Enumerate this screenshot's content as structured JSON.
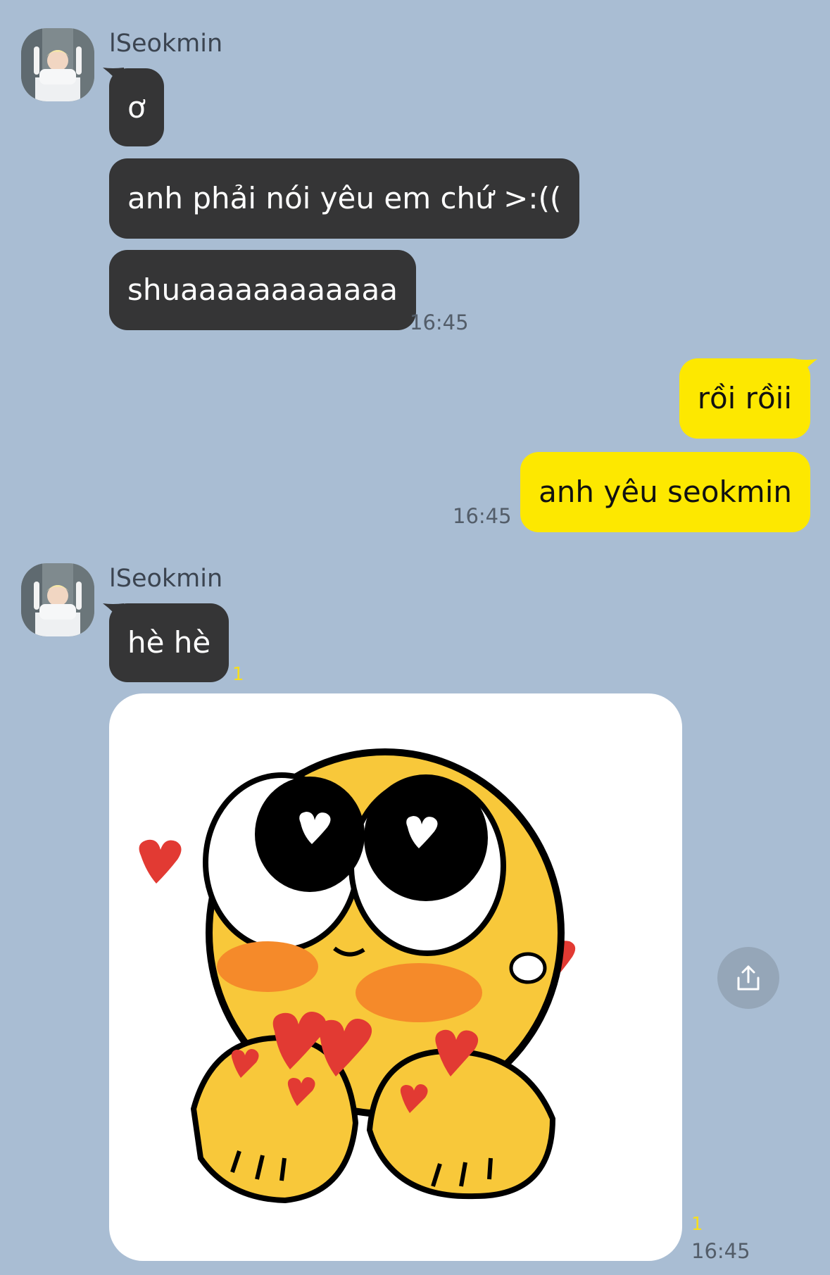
{
  "theme": {
    "background": "#a9bdd3",
    "incoming_bubble": "#353536",
    "outgoing_bubble": "#fde800",
    "unread_color": "#f7de1c"
  },
  "group1": {
    "sender": "lSeokmin",
    "messages": [
      "ơ",
      "anh phải nói yêu em chứ >:((",
      "shuaaaaaaaaaaaa"
    ],
    "time": "16:45"
  },
  "group2": {
    "messages": [
      "rồi rồii",
      "anh yêu seokmin"
    ],
    "time": "16:45"
  },
  "group3": {
    "sender": "lSeokmin",
    "message": "hè hè",
    "unread": "1",
    "sticker_unread": "1",
    "time": "16:45",
    "sticker_icon": "cursed-emoji-hearts-sticker"
  },
  "share": {
    "icon": "share-icon"
  }
}
